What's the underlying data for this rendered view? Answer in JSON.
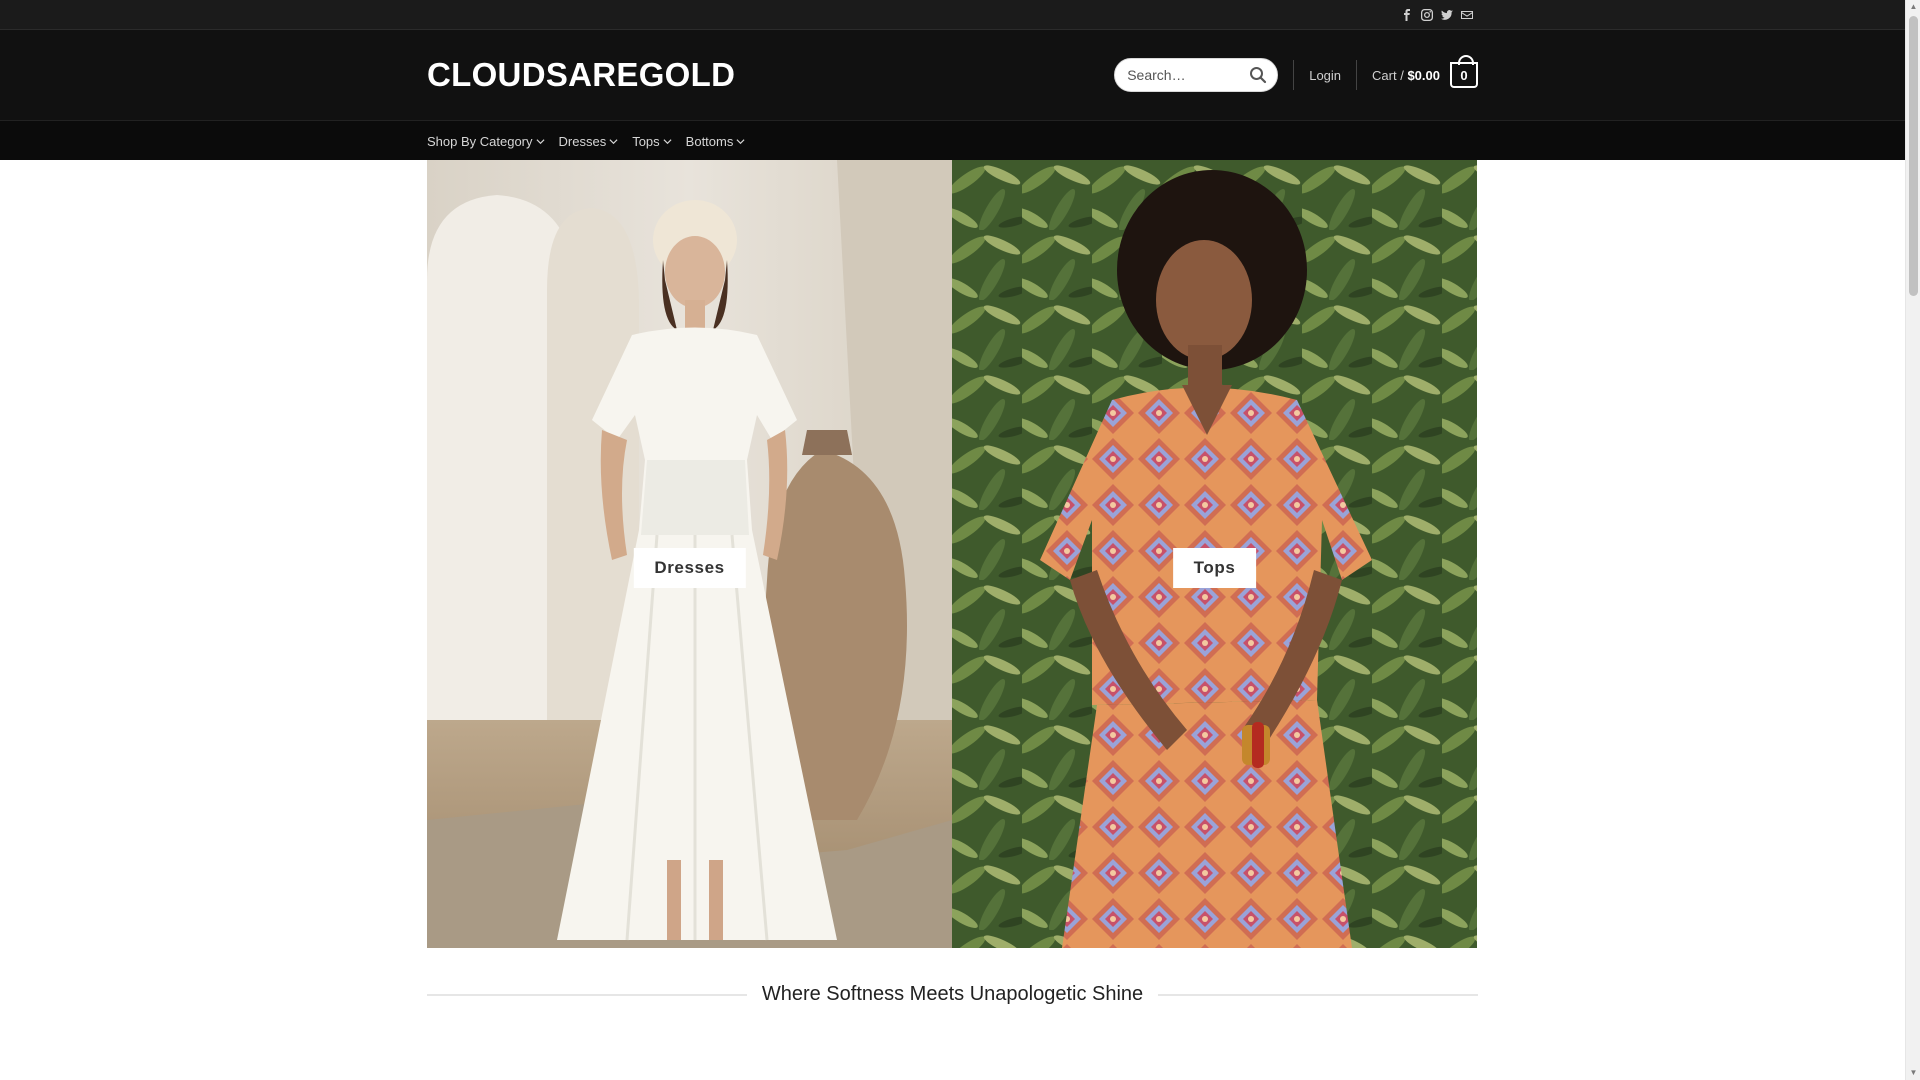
{
  "header": {
    "logo": "CLOUDSAREGOLD",
    "search_placeholder": "Search…",
    "login_label": "Login",
    "cart_prefix": "Cart /",
    "cart_total": "$0.00",
    "cart_count": "0"
  },
  "topbar": {
    "social_icons": [
      "facebook-icon",
      "instagram-icon",
      "twitter-icon",
      "email-icon"
    ]
  },
  "nav": {
    "items": [
      {
        "label": "Shop By Category"
      },
      {
        "label": "Dresses"
      },
      {
        "label": "Tops"
      },
      {
        "label": "Bottoms"
      }
    ]
  },
  "hero": {
    "panels": [
      {
        "button_label": "Dresses"
      },
      {
        "button_label": "Tops"
      }
    ]
  },
  "tagline": "Where Softness Meets Unapologetic Shine",
  "colors": {
    "topbar_bg": "#1b1b1b",
    "header_bg": "#111111",
    "navbar_bg": "#0b0b0b",
    "text_light": "#cfcfcf",
    "white": "#ffffff"
  }
}
